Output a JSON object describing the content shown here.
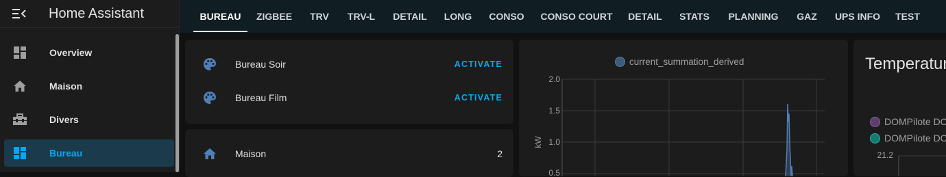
{
  "app": {
    "title": "Home Assistant"
  },
  "sidebar": {
    "items": [
      {
        "label": "Overview",
        "icon": "dashboard-icon"
      },
      {
        "label": "Maison",
        "icon": "home-icon"
      },
      {
        "label": "Divers",
        "icon": "toolbox-icon"
      },
      {
        "label": "Bureau",
        "icon": "dashboard-icon",
        "active": true
      }
    ]
  },
  "tabs": [
    "BUREAU",
    "ZIGBEE",
    "TRV",
    "TRV-L",
    "DETAIL",
    "LONG",
    "CONSO",
    "CONSO COURT",
    "DETAIL",
    "STATS",
    "PLANNING",
    "GAZ",
    "UPS INFO",
    "TEST"
  ],
  "scenes": {
    "rows": [
      {
        "name": "Bureau Soir",
        "action": "ACTIVATE",
        "icon": "palette-icon"
      },
      {
        "name": "Bureau Film",
        "action": "ACTIVATE",
        "icon": "palette-icon"
      }
    ]
  },
  "entities": {
    "rows": [
      {
        "name": "Maison",
        "value": "2",
        "icon": "home-icon"
      }
    ]
  },
  "chart_data": {
    "type": "line",
    "series": [
      {
        "name": "current_summation_derived",
        "color": "#3e6a92"
      }
    ],
    "ylabel": "kW",
    "yticks": [
      "2.0",
      "1.5",
      "1.0",
      "0.5"
    ],
    "ylim": [
      0.5,
      2.0
    ],
    "grid": true,
    "legend": "top"
  },
  "temperature_card": {
    "title": "Temperatur",
    "legend": [
      {
        "name": "DOMPilote DC",
        "color": "#7a4f8a"
      },
      {
        "name": "DOMPilote DC",
        "color": "#1aa59a"
      }
    ],
    "ytick": "21.2"
  },
  "colors": {
    "accent": "#03a9f4",
    "tabbar": "#101e24",
    "sidebar_active": "#1b3a4b",
    "icon": "#4f7fb8"
  }
}
